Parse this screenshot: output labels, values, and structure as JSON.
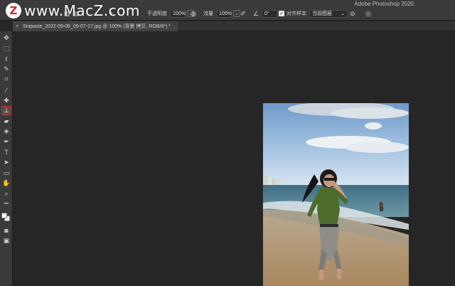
{
  "watermark": {
    "logo_letter": "Z",
    "text": "www.MacZ.com"
  },
  "app_title": "Adobe Photoshop 2020",
  "options_bar": {
    "opacity_label": "不透明度",
    "opacity_value": "100%",
    "flow_label": "流量",
    "flow_value": "100%",
    "angle_value": "0°",
    "aligned_label": "对齐",
    "sample_label": "样本",
    "sample_value": "当前图层"
  },
  "document_tab": {
    "close_glyph": "×",
    "title": "Snipaste_2022-09-06_09-07-17.jpg @ 100% (背景 拷贝, RGB/8*) *"
  },
  "toolbar": {
    "tools": [
      {
        "name": "move-tool",
        "icon": "move-icon",
        "glyph": "✥"
      },
      {
        "name": "marquee-tool",
        "icon": "marquee-icon",
        "glyph": "⬚"
      },
      {
        "name": "lasso-tool",
        "icon": "lasso-icon",
        "glyph": "ℓ"
      },
      {
        "name": "quick-select-tool",
        "icon": "quick-select-icon",
        "glyph": "✎"
      },
      {
        "name": "crop-tool",
        "icon": "crop-icon",
        "glyph": "⌗"
      },
      {
        "name": "eyedropper-tool",
        "icon": "eyedropper-icon",
        "glyph": "⁄"
      },
      {
        "name": "spot-healing-tool",
        "icon": "bandage-icon",
        "glyph": "✚"
      },
      {
        "name": "clone-stamp-tool",
        "icon": "stamp-icon",
        "glyph": "⊥",
        "active": true
      },
      {
        "name": "eraser-tool",
        "icon": "eraser-icon",
        "glyph": "▰"
      },
      {
        "name": "paint-bucket-tool",
        "icon": "bucket-icon",
        "glyph": "◈"
      },
      {
        "name": "pen-tool",
        "icon": "pen-icon",
        "glyph": "✒"
      },
      {
        "name": "type-tool",
        "icon": "type-icon",
        "glyph": "T"
      },
      {
        "name": "path-select-tool",
        "icon": "arrow-icon",
        "glyph": "➤"
      },
      {
        "name": "rectangle-tool",
        "icon": "rectangle-icon",
        "glyph": "▭"
      },
      {
        "name": "hand-tool",
        "icon": "hand-icon",
        "glyph": "✋"
      },
      {
        "name": "zoom-tool",
        "icon": "zoom-icon",
        "glyph": "⌕"
      },
      {
        "name": "more-tools",
        "icon": "ellipsis-icon",
        "glyph": "•••"
      }
    ]
  },
  "colors": {
    "accent": "#e02424",
    "panel": "#3a3a3a",
    "workspace": "#262626"
  }
}
